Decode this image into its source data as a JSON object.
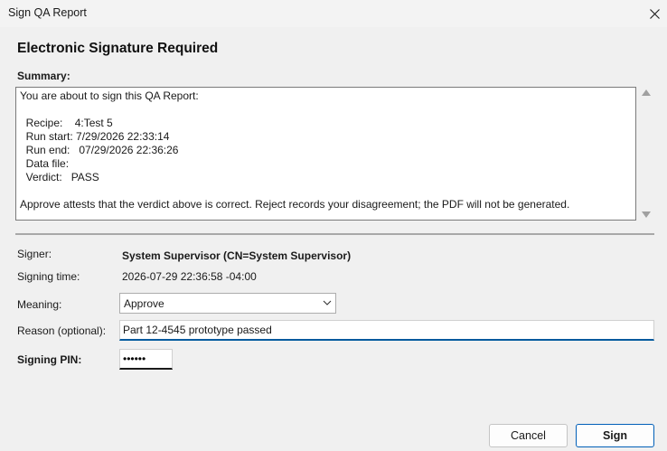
{
  "window": {
    "title": "Sign QA Report"
  },
  "heading": "Electronic Signature Required",
  "summary": {
    "label": "Summary:",
    "lines": [
      "You are about to sign this QA Report:",
      "",
      "  Recipe:    4:Test 5",
      "  Run start: 7/29/2026 22:33:14",
      "  Run end:   07/29/2026 22:36:26",
      "  Data file:",
      "  Verdict:   PASS",
      "",
      "Approve attests that the verdict above is correct. Reject records your disagreement; the PDF will not be generated."
    ]
  },
  "form": {
    "signer_label": "Signer:",
    "signer_value": "System Supervisor (CN=System Supervisor)",
    "time_label": "Signing time:",
    "time_value": "2026-07-29 22:36:58 -04:00",
    "meaning_label": "Meaning:",
    "meaning_value": "Approve",
    "reason_label": "Reason (optional):",
    "reason_value": "Part 12-4545 prototype passed",
    "pin_label": "Signing PIN:",
    "pin_value": "••••••"
  },
  "buttons": {
    "cancel": "Cancel",
    "sign": "Sign"
  },
  "icons": {
    "close": "close-icon",
    "dropdown": "chevron-down-icon"
  },
  "colors": {
    "accent": "#005fb8"
  }
}
